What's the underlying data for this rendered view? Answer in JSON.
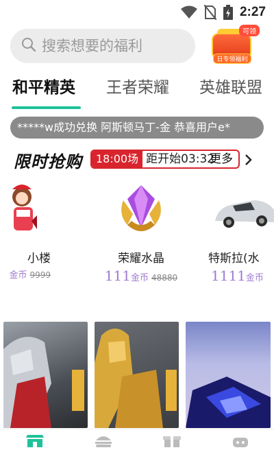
{
  "status": {
    "time": "2:27"
  },
  "search": {
    "placeholder": "搜索想要的福利"
  },
  "welfare_badge": {
    "tag": "可领",
    "label": "日专领福利"
  },
  "tabs": [
    {
      "label": "和平精英",
      "active": true
    },
    {
      "label": "王者荣耀",
      "active": false
    },
    {
      "label": "英雄联盟",
      "active": false
    }
  ],
  "ticker": {
    "text": "*****w成功兑换 阿斯顿马丁-金    恭喜用户e*"
  },
  "flash_sale": {
    "title_prefix": "限时抢购",
    "session": "18:00场",
    "countdown": "距开始03:32",
    "more": "更多"
  },
  "products": [
    {
      "name": "小楼",
      "price": "",
      "unit": "金币",
      "original": "9999"
    },
    {
      "name": "荣耀水晶",
      "price": "111",
      "unit": "金币",
      "original": "48880"
    },
    {
      "name": "特斯拉(水",
      "price": "1111",
      "unit": "金币",
      "original": ""
    }
  ],
  "colors": {
    "accent_green": "#1ec29a",
    "flash_red": "#d8242d",
    "price_purple": "#9f7ad0",
    "ticker_bg": "#8a8a8a"
  },
  "icons": {
    "search": "search-icon",
    "wifi": "wifi-icon",
    "no_sim": "no-sim-icon",
    "battery": "battery-icon",
    "chevron": "chevron-right-icon",
    "nav": [
      "shop-icon",
      "burger-icon",
      "gift-icon",
      "game-icon"
    ]
  }
}
